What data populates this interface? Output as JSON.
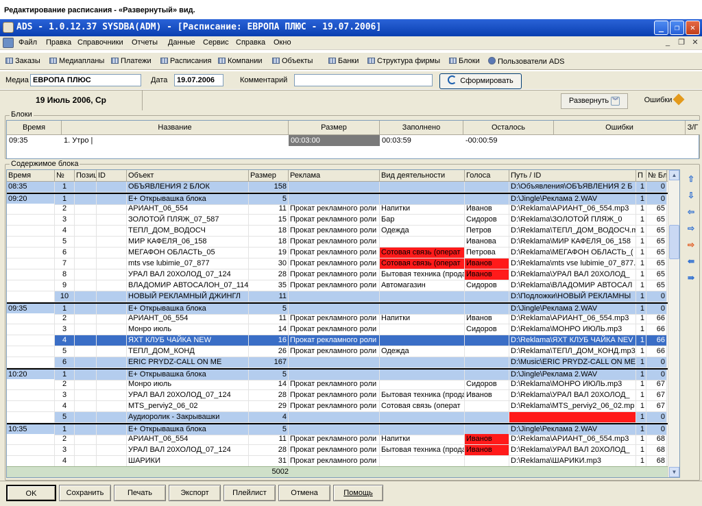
{
  "caption": "Редактирование расписания - «Развернутый» вид.",
  "window": {
    "title": "ADS - 1.0.12.37 SYSDBA(ADM) - [Расписание: ЕВРОПА ПЛЮС - 19.07.2006]"
  },
  "menu": [
    "Файл",
    "Правка",
    "Справочники",
    "Отчеты",
    "Данные",
    "Сервис",
    "Справка",
    "Окно"
  ],
  "toolbar": [
    "Заказы",
    "Медиапланы",
    "Платежи",
    "Расписания",
    "Компании",
    "Объекты",
    "Банки",
    "Структура фирмы",
    "Блоки",
    "Пользователи ADS"
  ],
  "params": {
    "media_label": "Медиа",
    "media_value": "ЕВРОПА ПЛЮС",
    "date_label": "Дата",
    "date_value": "19.07.2006",
    "comment_label": "Комментарий",
    "comment_value": "",
    "form_button": "Сформировать"
  },
  "date_banner": "19 Июль 2006, Ср",
  "expand_button": "Развернуть",
  "errors_button": "Ошибки",
  "blocks": {
    "group_label": "Блоки",
    "headers": [
      "Время",
      "Название",
      "Размер",
      "Заполнено",
      "Осталось",
      "Ошибки",
      "З/Г"
    ],
    "row": {
      "time": "09:35",
      "name": "1. Утро |",
      "size": "00:03:00",
      "filled": "00:03:59",
      "remaining": "-00:00:59",
      "errors": "",
      "zg": ""
    }
  },
  "content": {
    "group_label": "Содержимое блока",
    "headers": [
      "Время",
      "№",
      "Позиция",
      "ID",
      "Объект",
      "Размер",
      "Реклама",
      "Вид деятельности",
      "Голоса",
      "Путь / ID",
      "П",
      "№ Блока"
    ],
    "rows": [
      {
        "t": "08:35",
        "n": "1",
        "obj": "ОБЪЯВЛЕНИЯ 2 БЛОК",
        "size": "158",
        "adv": "",
        "act": "",
        "voice": "",
        "path": "D:\\Объявления\\ОБЪЯВЛЕНИЯ 2 Б",
        "p": "1",
        "blk": "0",
        "style": "blue",
        "grp": false
      },
      {
        "t": "09:20",
        "n": "1",
        "obj": "Е+ Открывашка блока",
        "size": "5",
        "adv": "",
        "act": "",
        "voice": "",
        "path": "D:\\Jingle\\Реклама 2.WAV",
        "p": "1",
        "blk": "0",
        "style": "blue",
        "grp": true
      },
      {
        "t": "",
        "n": "2",
        "obj": "АРИАНТ_06_554",
        "size": "11",
        "adv": "Прокат рекламного роли",
        "act": "Напитки",
        "voice": "Иванов",
        "path": "D:\\Reklama\\АРИАНТ_06_554.mp3",
        "p": "1",
        "blk": "65",
        "style": "",
        "grp": false
      },
      {
        "t": "",
        "n": "3",
        "obj": "ЗОЛОТОЙ ПЛЯЖ_07_587",
        "size": "15",
        "adv": "Прокат рекламного роли",
        "act": "Бар",
        "voice": "Сидоров",
        "path": "D:\\Reklama\\ЗОЛОТОЙ ПЛЯЖ_0",
        "p": "1",
        "blk": "65",
        "style": "",
        "grp": false
      },
      {
        "t": "",
        "n": "4",
        "obj": "ТЕПЛ_ДОМ_ВОДОСЧ",
        "size": "18",
        "adv": "Прокат рекламного роли",
        "act": "Одежда",
        "voice": "Петров",
        "path": "D:\\Reklama\\ТЕПЛ_ДОМ_ВОДОСЧ.m",
        "p": "1",
        "blk": "65",
        "style": "",
        "grp": false
      },
      {
        "t": "",
        "n": "5",
        "obj": "МИР КАФЕЛЯ_06_158",
        "size": "18",
        "adv": "Прокат рекламного роли",
        "act": "",
        "voice": "Иванова",
        "path": "D:\\Reklama\\МИР КАФЕЛЯ_06_158",
        "p": "1",
        "blk": "65",
        "style": "",
        "grp": false
      },
      {
        "t": "",
        "n": "6",
        "obj": "МЕГАФОН ОБЛАСТЬ_05",
        "size": "19",
        "adv": "Прокат рекламного роли",
        "act": "Сотовая связь (операт",
        "voice": "Петрова",
        "path": "D:\\Reklama\\МЕГАФОН ОБЛАСТЬ_(",
        "p": "1",
        "blk": "65",
        "style": "",
        "grp": false,
        "red_act": true
      },
      {
        "t": "",
        "n": "7",
        "obj": "mts vse lubimie_07_877",
        "size": "30",
        "adv": "Прокат рекламного роли",
        "act": "Сотовая связь (операт",
        "voice": "Иванов",
        "path": "D:\\Reklama\\mts vse lubimie_07_877.(",
        "p": "1",
        "blk": "65",
        "style": "",
        "grp": false,
        "red_act": true,
        "red_voice": true
      },
      {
        "t": "",
        "n": "8",
        "obj": "УРАЛ ВАЛ 20ХОЛОД_07_124",
        "size": "28",
        "adv": "Прокат рекламного роли",
        "act": "Бытовая техника (прода",
        "voice": "Иванов",
        "path": "D:\\Reklama\\УРАЛ ВАЛ 20ХОЛОД_",
        "p": "1",
        "blk": "65",
        "style": "",
        "grp": false,
        "red_voice": true
      },
      {
        "t": "",
        "n": "9",
        "obj": "ВЛАДОМИР АВТОСАЛОН_07_114",
        "size": "35",
        "adv": "Прокат рекламного роли",
        "act": "Автомагазин",
        "voice": "Сидоров",
        "path": "D:\\Reklama\\ВЛАДОМИР АВТОСАЛ",
        "p": "1",
        "blk": "65",
        "style": "",
        "grp": false
      },
      {
        "t": "",
        "n": "10",
        "obj": "НОВЫЙ РЕКЛАМНЫЙ ДЖИНГЛ",
        "size": "11",
        "adv": "",
        "act": "",
        "voice": "",
        "path": "D:\\Подложки\\НОВЫЙ РЕКЛАМНЫ",
        "p": "1",
        "blk": "0",
        "style": "blue",
        "grp": false
      },
      {
        "t": "09:35",
        "n": "1",
        "obj": "Е+ Открывашка блока",
        "size": "5",
        "adv": "",
        "act": "",
        "voice": "",
        "path": "D:\\Jingle\\Реклама 2.WAV",
        "p": "1",
        "blk": "0",
        "style": "blue",
        "grp": true
      },
      {
        "t": "",
        "n": "2",
        "obj": "АРИАНТ_06_554",
        "size": "11",
        "adv": "Прокат рекламного роли",
        "act": "Напитки",
        "voice": "Иванов",
        "path": "D:\\Reklama\\АРИАНТ_06_554.mp3",
        "p": "1",
        "blk": "66",
        "style": "",
        "grp": false
      },
      {
        "t": "",
        "n": "3",
        "obj": "Монро июль",
        "size": "14",
        "adv": "Прокат рекламного роли",
        "act": "",
        "voice": "Сидоров",
        "path": "D:\\Reklama\\МОНРО ИЮЛЬ.mp3",
        "p": "1",
        "blk": "66",
        "style": "",
        "grp": false
      },
      {
        "t": "",
        "n": "4",
        "obj": "ЯХТ КЛУБ ЧАЙКА NEW",
        "size": "16",
        "adv": "Прокат рекламного роли",
        "act": "",
        "voice": "",
        "path": "D:\\Reklama\\ЯХТ КЛУБ ЧАЙКА NEV",
        "p": "1",
        "blk": "66",
        "style": "sel",
        "grp": false
      },
      {
        "t": "",
        "n": "5",
        "obj": "ТЕПЛ_ДОМ_КОНД",
        "size": "26",
        "adv": "Прокат рекламного роли",
        "act": "Одежда",
        "voice": "",
        "path": "D:\\Reklama\\ТЕПЛ_ДОМ_КОНД.mp3",
        "p": "1",
        "blk": "66",
        "style": "",
        "grp": false
      },
      {
        "t": "",
        "n": "6",
        "obj": "ERIC PRYDZ-CALL ON ME",
        "size": "167",
        "adv": "",
        "act": "",
        "voice": "",
        "path": "D:\\Music\\ERIC PRYDZ-CALL ON ME",
        "p": "1",
        "blk": "0",
        "style": "blue",
        "grp": false
      },
      {
        "t": "10:20",
        "n": "1",
        "obj": "Е+ Открывашка блока",
        "size": "5",
        "adv": "",
        "act": "",
        "voice": "",
        "path": "D:\\Jingle\\Реклама 2.WAV",
        "p": "1",
        "blk": "0",
        "style": "blue",
        "grp": true
      },
      {
        "t": "",
        "n": "2",
        "obj": "Монро июль",
        "size": "14",
        "adv": "Прокат рекламного роли",
        "act": "",
        "voice": "Сидоров",
        "path": "D:\\Reklama\\МОНРО ИЮЛЬ.mp3",
        "p": "1",
        "blk": "67",
        "style": "",
        "grp": false
      },
      {
        "t": "",
        "n": "3",
        "obj": "УРАЛ ВАЛ 20ХОЛОД_07_124",
        "size": "28",
        "adv": "Прокат рекламного роли",
        "act": "Бытовая техника (прода",
        "voice": "Иванов",
        "path": "D:\\Reklama\\УРАЛ ВАЛ 20ХОЛОД_",
        "p": "1",
        "blk": "67",
        "style": "",
        "grp": false
      },
      {
        "t": "",
        "n": "4",
        "obj": "MTS_perviy2_06_02",
        "size": "29",
        "adv": "Прокат рекламного роли",
        "act": "Сотовая связь (операт",
        "voice": "",
        "path": "D:\\Reklama\\MTS_perviy2_06_02.mp",
        "p": "1",
        "blk": "67",
        "style": "",
        "grp": false
      },
      {
        "t": "",
        "n": "5",
        "obj": "Аудиоролик - Закрывашки",
        "size": "4",
        "adv": "",
        "act": "",
        "voice": "",
        "path": "",
        "p": "1",
        "blk": "0",
        "style": "blue",
        "grp": false,
        "red_path": true
      },
      {
        "t": "10:35",
        "n": "1",
        "obj": "Е+ Открывашка блока",
        "size": "5",
        "adv": "",
        "act": "",
        "voice": "",
        "path": "D:\\Jingle\\Реклама 2.WAV",
        "p": "1",
        "blk": "0",
        "style": "blue",
        "grp": true
      },
      {
        "t": "",
        "n": "2",
        "obj": "АРИАНТ_06_554",
        "size": "11",
        "adv": "Прокат рекламного роли",
        "act": "Напитки",
        "voice": "Иванов",
        "path": "D:\\Reklama\\АРИАНТ_06_554.mp3",
        "p": "1",
        "blk": "68",
        "style": "",
        "grp": false,
        "red_voice": true
      },
      {
        "t": "",
        "n": "3",
        "obj": "УРАЛ ВАЛ 20ХОЛОД_07_124",
        "size": "28",
        "adv": "Прокат рекламного роли",
        "act": "Бытовая техника (прода",
        "voice": "Иванов",
        "path": "D:\\Reklama\\УРАЛ ВАЛ 20ХОЛОД_",
        "p": "1",
        "blk": "68",
        "style": "",
        "grp": false,
        "red_voice": true
      },
      {
        "t": "",
        "n": "4",
        "obj": "ШАРИКИ",
        "size": "31",
        "adv": "Прокат рекламного роли",
        "act": "",
        "voice": "",
        "path": "D:\\Reklama\\ШАРИКИ.mp3",
        "p": "1",
        "blk": "68",
        "style": "",
        "grp": false
      }
    ],
    "total": "5002"
  },
  "buttons": [
    "OK",
    "Сохранить",
    "Печать",
    "Экспорт",
    "Плейлист",
    "Отмена",
    "Помощь"
  ]
}
